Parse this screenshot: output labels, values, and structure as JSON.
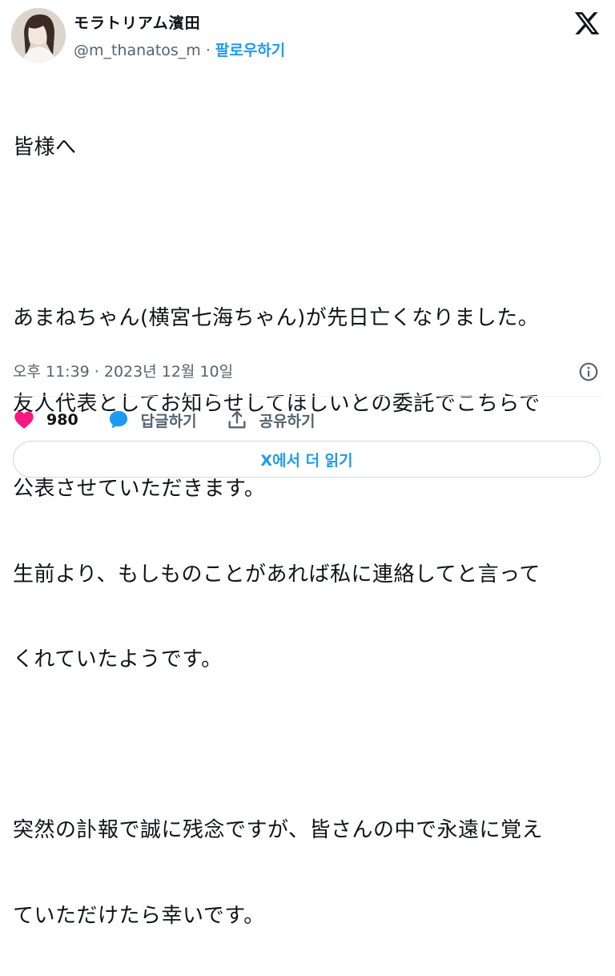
{
  "header": {
    "display_name": "モラトリアム濱田",
    "handle": "@m_thanatos_m",
    "separator": "·",
    "follow_label": "팔로우하기"
  },
  "tweet": {
    "lines": [
      "皆様へ",
      "",
      "あまねちゃん(横宮七海ちゃん)が先日亡くなりました。",
      "友人代表としてお知らせしてほしいとの委託でこちらで",
      "公表させていただきます。",
      "生前より、もしものことがあれば私に連絡してと言って",
      "くれていたようです。",
      "",
      "突然の訃報で誠に残念ですが、皆さんの中で永遠に覚え",
      "ていただけたら幸いです。"
    ]
  },
  "meta": {
    "timestamp": "오후 11:39 · 2023년 12월 10일"
  },
  "actions": {
    "like_count": "980",
    "reply_label": "답글하기",
    "share_label": "공유하기"
  },
  "read_more": {
    "label": "X에서 더 읽기"
  },
  "colors": {
    "accent": "#1d9bf0",
    "like": "#f91880",
    "muted": "#536471",
    "text": "#0f1419",
    "border": "#cfd9de"
  },
  "icons": {
    "brand": "x-logo-icon",
    "info": "info-icon",
    "like": "heart-icon",
    "reply": "speech-bubble-icon",
    "share": "share-upload-icon"
  }
}
